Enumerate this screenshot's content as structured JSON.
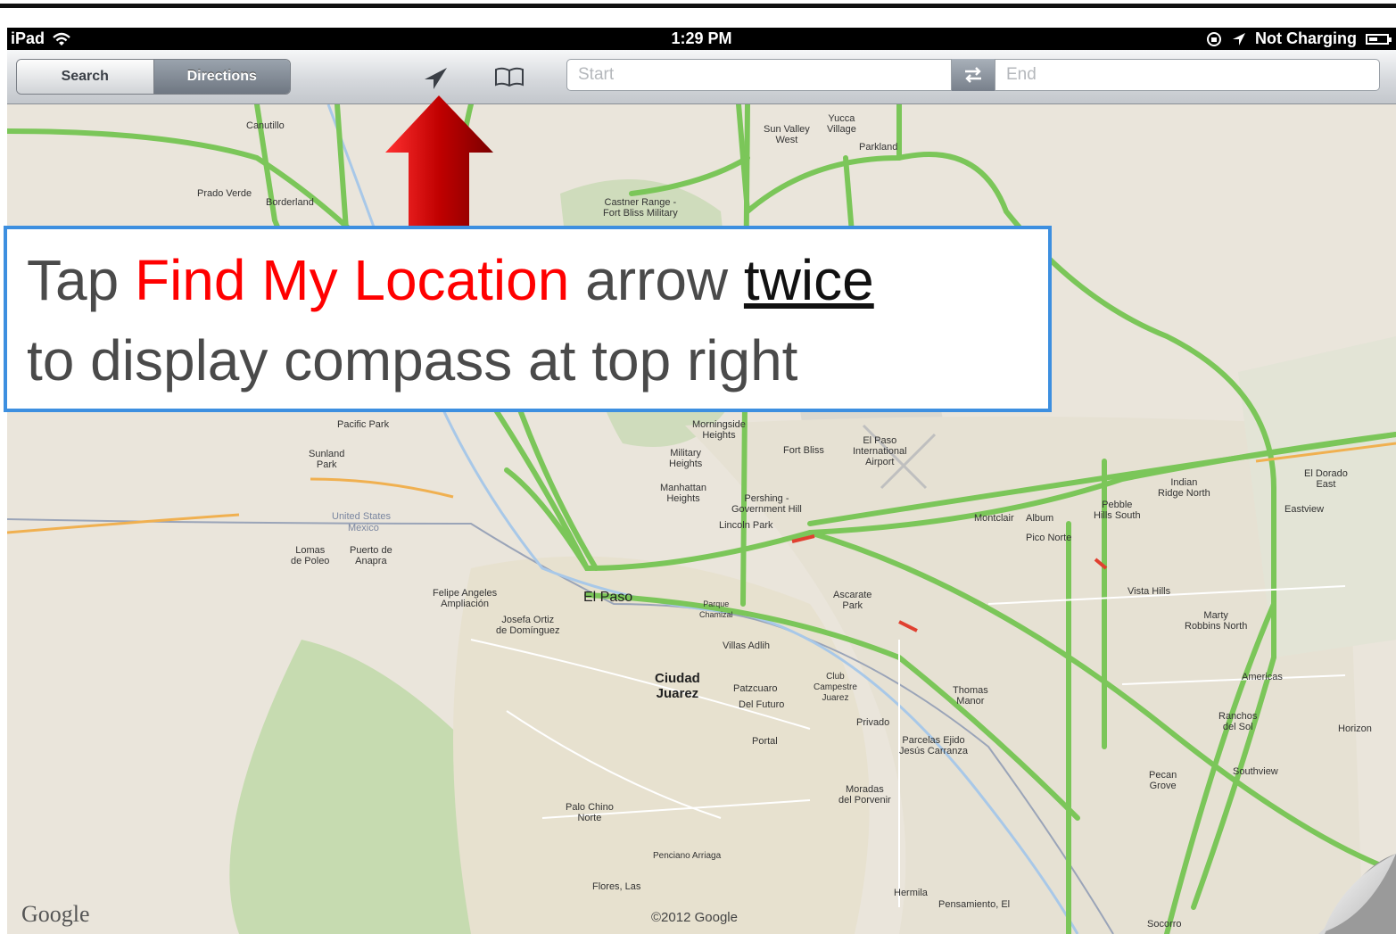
{
  "status_bar": {
    "device": "iPad",
    "time": "1:29 PM",
    "charging": "Not Charging"
  },
  "toolbar": {
    "segments": [
      "Search",
      "Directions"
    ],
    "selected_segment": "Directions",
    "start_placeholder": "Start",
    "end_placeholder": "End",
    "icons": [
      "locate-arrow-icon",
      "bookmarks-book-icon",
      "swap-arrows-icon"
    ]
  },
  "map": {
    "provider_logo": "Google",
    "copyright": "©2012 Google",
    "labels": {
      "canutillo": "Canutillo",
      "prado_verde": "Prado Verde",
      "borderland": "Borderland",
      "sun_valley_west": "Sun Valley\nWest",
      "yucca_village": "Yucca\nVillage",
      "parkland": "Parkland",
      "castner_range": "Castner Range -\nFort Bliss Military",
      "pacific_park": "Pacific Park",
      "morningside_heights": "Morningside\nHeights",
      "fort_bliss": "Fort Bliss",
      "el_paso_airport": "El Paso\nInternational\nAirport",
      "military_heights": "Military\nHeights",
      "manhattan_heights": "Manhattan\nHeights",
      "sunland_park": "Sunland\nPark",
      "pershing": "Pershing -\nGovernment Hill",
      "lincoln_park": "Lincoln Park",
      "united_states": "United States",
      "mexico": "Mexico",
      "lomas_de_poleo": "Lomas\nde Poleo",
      "puerto_de_anapra": "Puerto de\nAnapra",
      "felipe_angeles": "Felipe Angeles\nAmpliación",
      "el_paso": "El Paso",
      "josefa_ortiz": "Josefa Ortiz\nde Domínguez",
      "parque_chamizal": "Parque\nChamizal",
      "ascarate_park": "Ascarate\nPark",
      "villas_adlih": "Villas Adlih",
      "ciudad_juarez": "Ciudad\nJuarez",
      "patzcuaro": "Patzcuaro",
      "del_futuro": "Del Futuro",
      "club_campestre": "Club\nCampestre\nJuarez",
      "thomas_manor": "Thomas\nManor",
      "privado": "Privado",
      "portal": "Portal",
      "parcelas": "Parcelas Ejido\nJesús Carranza",
      "moradas": "Moradas\ndel Porvenir",
      "palo_chino": "Palo Chino\nNorte",
      "penciano_arriaga": "Penciano Arriaga",
      "flores_las": "Flores, Las",
      "hermila": "Hermila",
      "pensamiento": "Pensamiento, El",
      "montclair": "Montclair",
      "album": "Album",
      "pico_norte": "Pico Norte",
      "pebble_hills": "Pebble\nHills South",
      "indian_ridge": "Indian\nRidge North",
      "el_dorado_east": "El Dorado\nEast",
      "eastview": "Eastview",
      "vista_hills": "Vista Hills",
      "marty_robbins": "Marty\nRobbins North",
      "americas": "Americas",
      "ranchos_del_sol": "Ranchos\ndel Sol",
      "horizon": "Horizon",
      "pecan_grove": "Pecan\nGrove",
      "southview": "Southview",
      "socorro": "Socorro"
    }
  },
  "callout": {
    "line1_prefix": "Tap ",
    "line1_highlight": "Find My Location",
    "line1_middle": " arrow ",
    "line1_emphasis": "twice",
    "line2": "to display compass at top right",
    "highlight_color": "#ff0000",
    "border_color": "#3d8fe0"
  },
  "pointer_arrow": {
    "color": "#c00000",
    "points_to": "locate-arrow-icon"
  }
}
